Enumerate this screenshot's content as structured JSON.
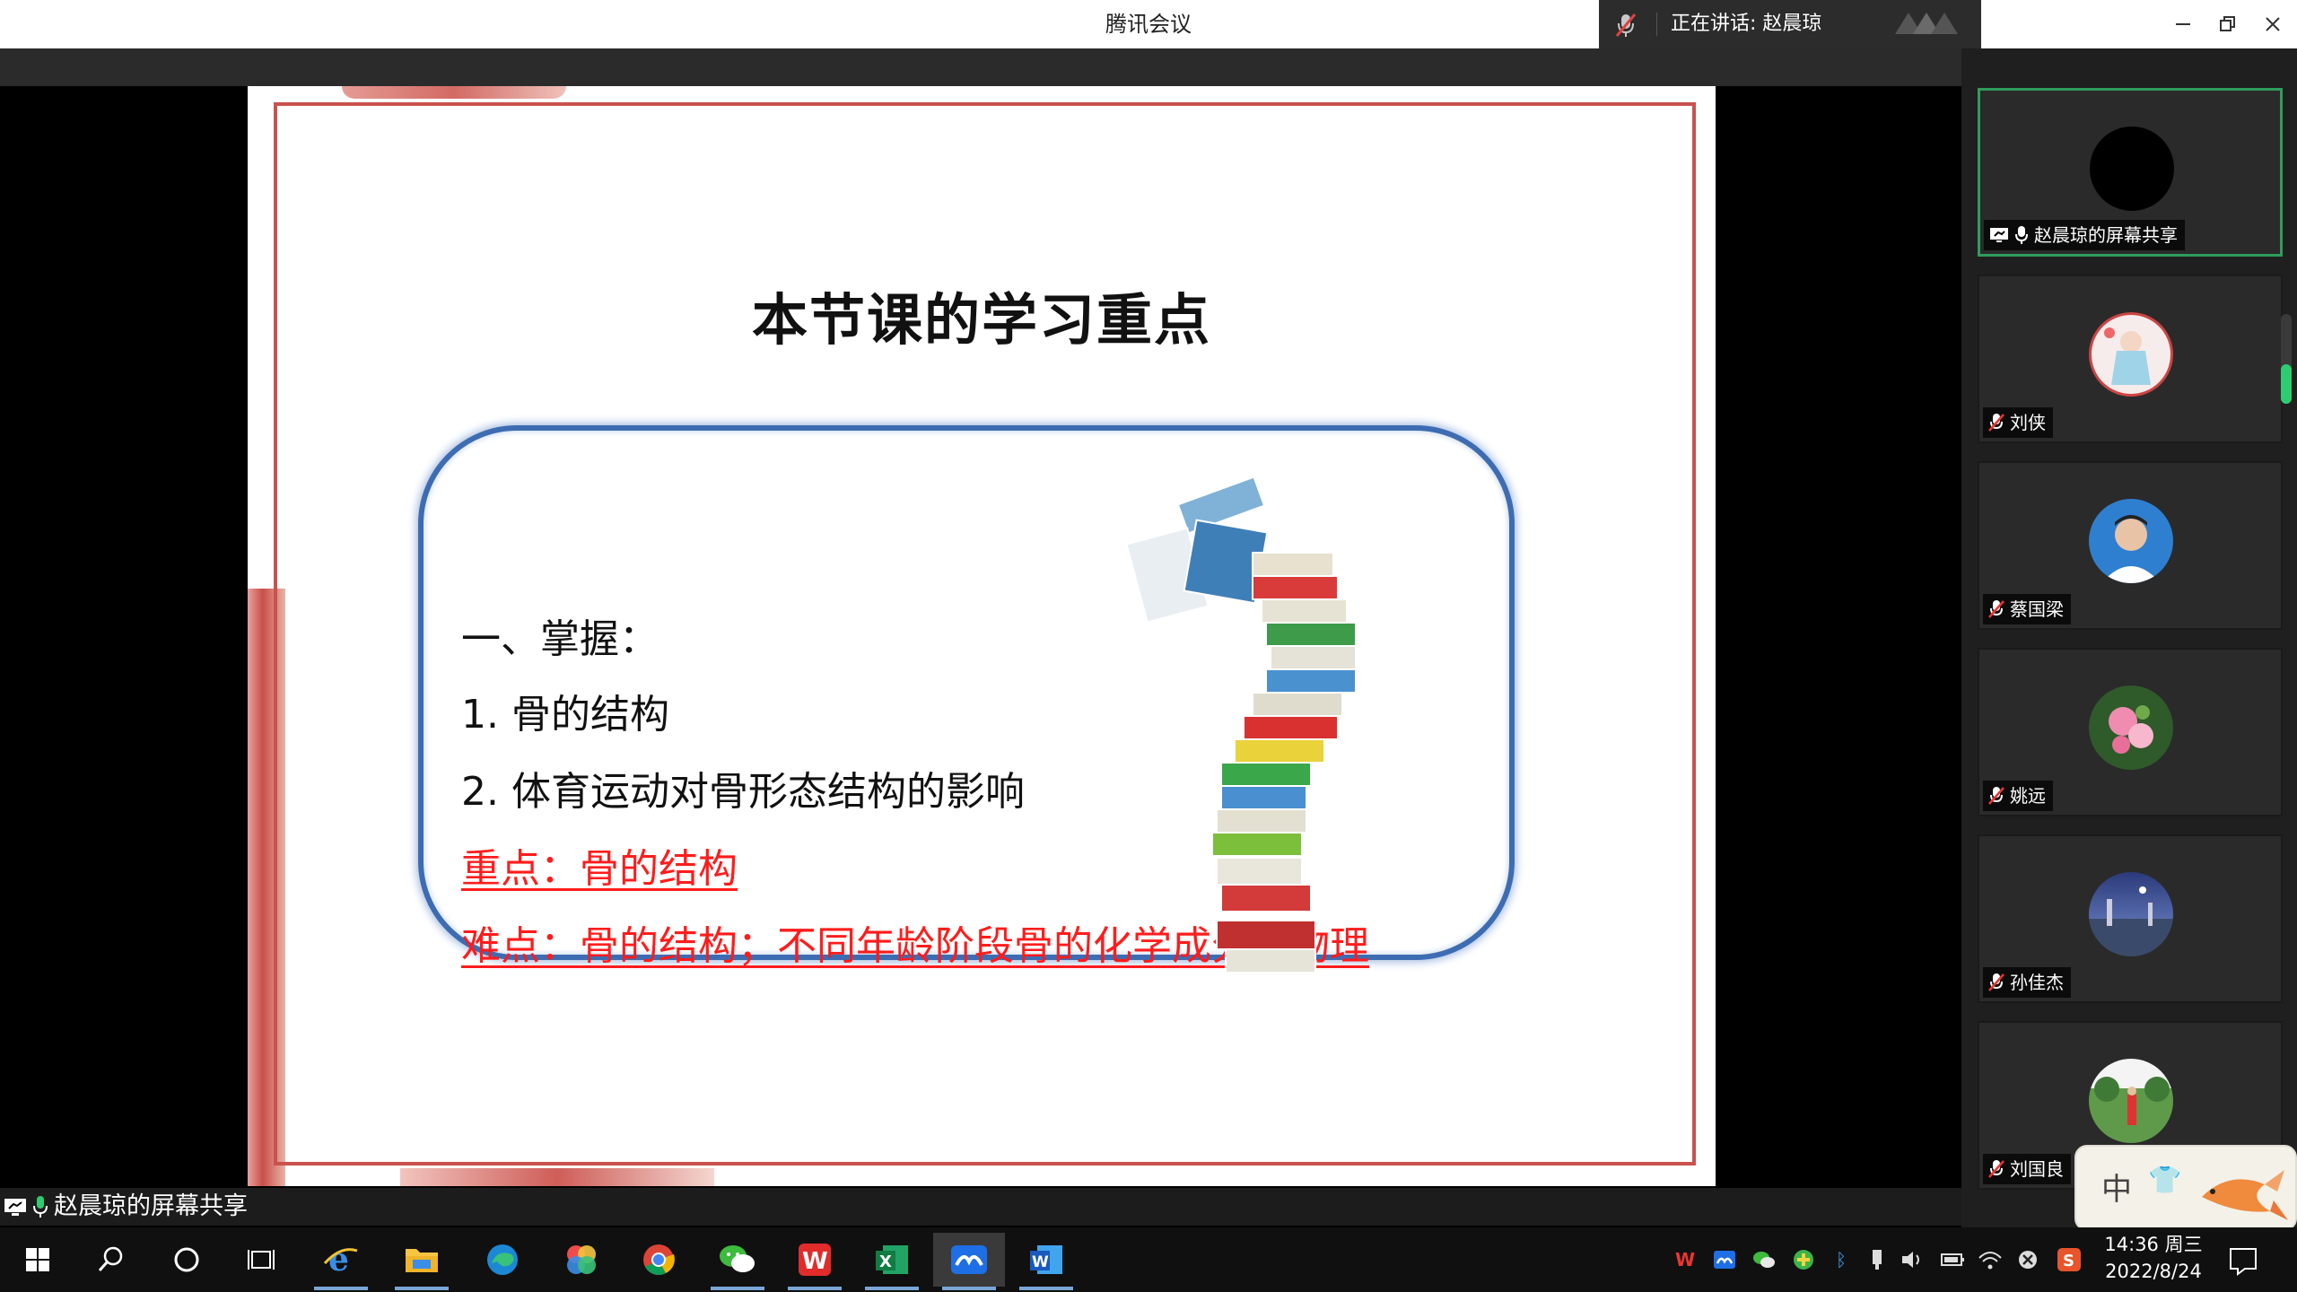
{
  "window": {
    "title": "腾讯会议"
  },
  "speaker": {
    "status": "正在讲话: 赵晨琼"
  },
  "slide": {
    "title": "本节课的学习重点",
    "lines": [
      "一、掌握：",
      "1. 骨的结构",
      "2. 体育运动对骨形态结构的影响",
      "重点：骨的结构",
      "难点：骨的结构；不同年龄阶段骨的化学成分和物理"
    ]
  },
  "participants": [
    {
      "name": "赵晨琼的屏幕共享",
      "avatar": "black-circle",
      "sharing": true
    },
    {
      "name": "刘侠",
      "avatar": "cartoon-girl"
    },
    {
      "name": "蔡国梁",
      "avatar": "man-portrait"
    },
    {
      "name": "姚远",
      "avatar": "flowers"
    },
    {
      "name": "孙佳杰",
      "avatar": "night-city"
    },
    {
      "name": "刘国良",
      "avatar": "park-photo"
    }
  ],
  "share_label": "赵晨琼的屏幕共享",
  "ime": {
    "mode": "中"
  },
  "taskbar": {
    "apps": [
      "start",
      "search",
      "cortana",
      "task-view",
      "ie",
      "file-explorer",
      "edge",
      "photos",
      "chrome",
      "wechat",
      "wps",
      "excel",
      "tencent-meeting",
      "word"
    ]
  },
  "clock": {
    "time": "14:36 周三",
    "date": "2022/8/24"
  },
  "colors": {
    "accent_red": "#ff1c1c",
    "box_blue": "#3d6cb2",
    "frame_red": "#c9524d",
    "active_green": "#2e9d5b"
  }
}
